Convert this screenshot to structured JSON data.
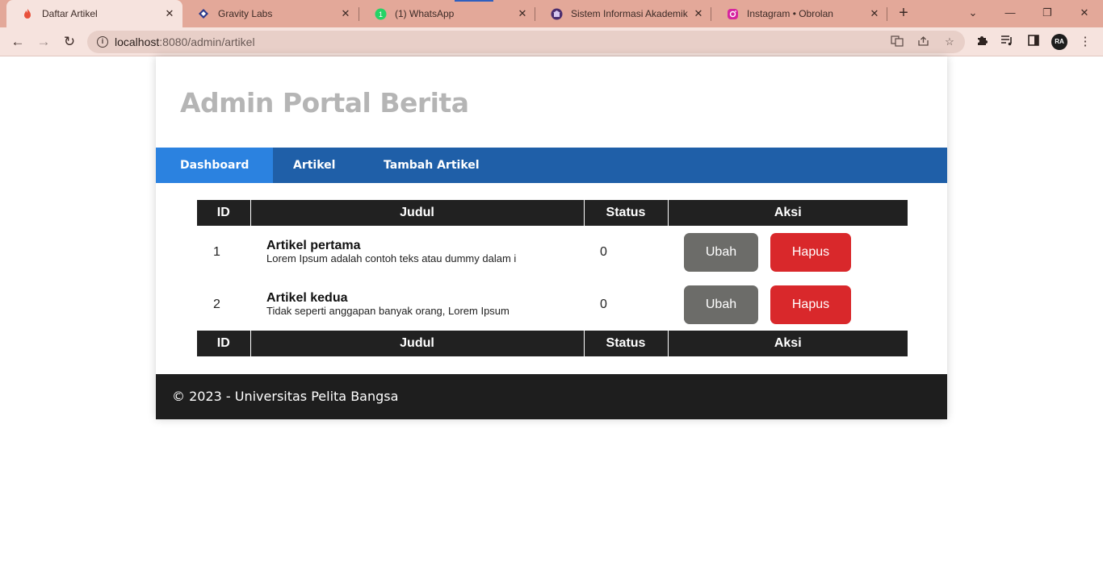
{
  "browser": {
    "tabs": [
      {
        "title": "Daftar Artikel",
        "icon": "flame-icon",
        "active": true
      },
      {
        "title": "Gravity Labs",
        "icon": "diamond-icon",
        "active": false
      },
      {
        "title": "(1) WhatsApp",
        "icon": "whatsapp-icon",
        "active": false
      },
      {
        "title": "Sistem Informasi Akademik",
        "icon": "university-icon",
        "active": false
      },
      {
        "title": "Instagram • Obrolan",
        "icon": "instagram-icon",
        "active": false
      }
    ],
    "url_host": "localhost",
    "url_rest": ":8080/admin/artikel",
    "profile_initials": "RA"
  },
  "page": {
    "site_title": "Admin Portal Berita",
    "nav": [
      {
        "label": "Dashboard",
        "active": true
      },
      {
        "label": "Artikel",
        "active": false
      },
      {
        "label": "Tambah Artikel",
        "active": false
      }
    ],
    "table": {
      "headers": [
        "ID",
        "Judul",
        "Status",
        "Aksi"
      ],
      "rows": [
        {
          "id": "1",
          "title": "Artikel pertama",
          "excerpt": "Lorem Ipsum adalah contoh teks atau dummy dalam i",
          "status": "0",
          "edit_label": "Ubah",
          "delete_label": "Hapus"
        },
        {
          "id": "2",
          "title": "Artikel kedua",
          "excerpt": "Tidak seperti anggapan banyak orang, Lorem Ipsum",
          "status": "0",
          "edit_label": "Ubah",
          "delete_label": "Hapus"
        }
      ]
    },
    "footer": "© 2023 - Universitas Pelita Bangsa"
  },
  "colors": {
    "nav_bg": "#1f5fa8",
    "nav_active": "#2b82e0",
    "table_header": "#212121",
    "btn_ubah": "#6c6c69",
    "btn_hapus": "#d9282b",
    "footer_bg": "#1e1e1e"
  }
}
